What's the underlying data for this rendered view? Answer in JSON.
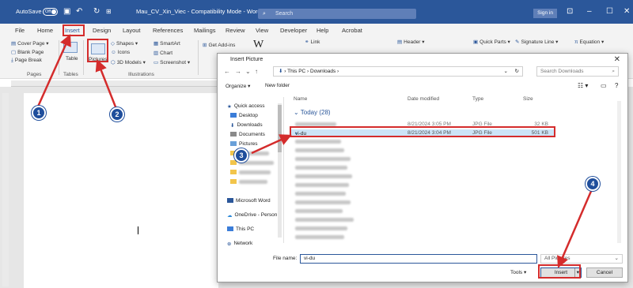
{
  "titlebar": {
    "autosave": "AutoSave",
    "toggle": "Off",
    "doc_title": "Mau_CV_Xin_Viec - Compatibility Mode - Word",
    "search_placeholder": "Search",
    "signin": "Sign in",
    "bg_color": "#2b579a"
  },
  "tabs": [
    "File",
    "Home",
    "Insert",
    "Design",
    "Layout",
    "References",
    "Mailings",
    "Review",
    "View",
    "Developer",
    "Help",
    "Acrobat"
  ],
  "ribbon": {
    "pages": [
      "Cover Page",
      "Blank Page",
      "Page Break"
    ],
    "pages_group": "Pages",
    "table": "Table",
    "tables_group": "Tables",
    "pictures": "Pictures",
    "shapes": "Shapes",
    "icons": "Icons",
    "models": "3D Models",
    "smartart": "SmartArt",
    "chart": "Chart",
    "screenshot": "Screenshot",
    "illustrations_group": "Illustrations",
    "addins": "Get Add-ins",
    "link": "Link",
    "header": "Header",
    "quickparts": "Quick Parts",
    "signature": "Signature Line",
    "equation": "Equation"
  },
  "dialog": {
    "title": "Insert Picture",
    "path": [
      "This PC",
      "Downloads"
    ],
    "search_placeholder": "Search Downloads",
    "organize": "Organize",
    "new_folder": "New folder",
    "nav": [
      "Quick access",
      "Desktop",
      "Downloads",
      "Documents",
      "Pictures",
      "Microsoft Word",
      "OneDrive - Person",
      "This PC",
      "Network"
    ],
    "columns": [
      "Name",
      "Date modified",
      "Type",
      "Size"
    ],
    "group": "Today (28)",
    "rows": [
      {
        "name": "",
        "date": "8/21/2024 3:05 PM",
        "type": "JPG File",
        "size": "32 KB",
        "selected": false
      },
      {
        "name": "vi-du",
        "date": "8/21/2024 3:04 PM",
        "type": "JPG File",
        "size": "501 KB",
        "selected": true
      }
    ],
    "filename_label": "File name:",
    "filename_value": "vi-du",
    "filetype": "All Pictures",
    "tools": "Tools",
    "insert": "Insert",
    "cancel": "Cancel"
  },
  "markers": [
    "1",
    "2",
    "3",
    "4"
  ],
  "highlight_color": "#d42c2c",
  "marker_color": "#1f4e9c"
}
